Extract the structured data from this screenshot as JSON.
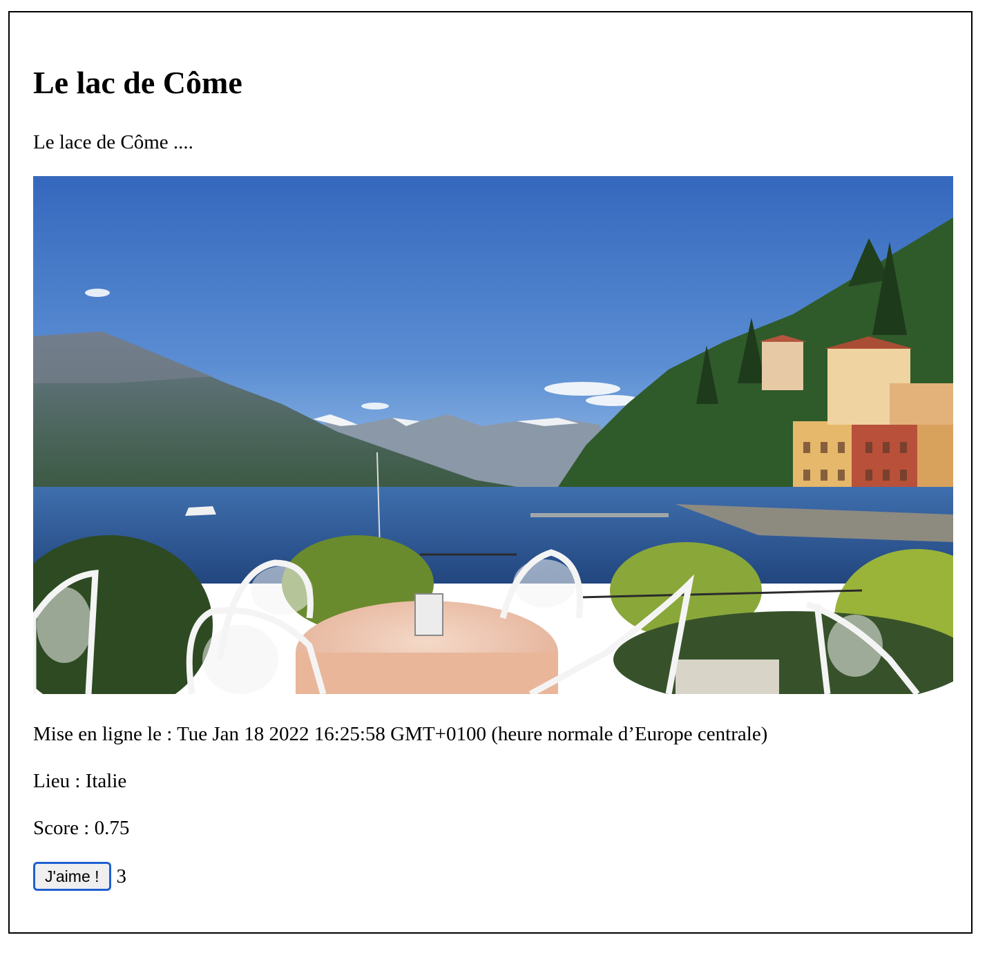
{
  "article": {
    "title": "Le lac de Côme",
    "description": "Le lace de Côme ....",
    "photo_subject": "Le lac de Côme",
    "date_line": "Mise en ligne le : Tue Jan 18 2022 16:25:58 GMT+0100 (heure normale d’Europe centrale)",
    "place_line": "Lieu : Italie",
    "score_line": "Score : 0.75",
    "like_button_label": "J'aime !",
    "like_count": "3"
  },
  "colors": {
    "button_border": "#1f5fd0",
    "sky_top": "#3a6fc0",
    "lake": "#2d5a9a"
  }
}
